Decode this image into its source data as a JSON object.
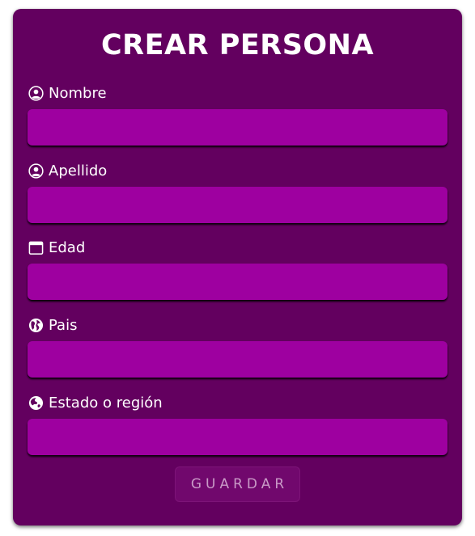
{
  "form": {
    "title": "CREAR PERSONA",
    "fields": [
      {
        "label": "Nombre",
        "icon": "user-circle-icon",
        "value": ""
      },
      {
        "label": "Apellido",
        "icon": "user-circle-icon",
        "value": ""
      },
      {
        "label": "Edad",
        "icon": "calendar-icon",
        "value": ""
      },
      {
        "label": "Pais",
        "icon": "globe-americas-icon",
        "value": ""
      },
      {
        "label": "Estado o región",
        "icon": "globe-asia-icon",
        "value": ""
      }
    ],
    "save_label": "GUARDAR"
  },
  "colors": {
    "card_background": "#63005f",
    "input_background": "#9e00a0",
    "text": "#ffffff",
    "button_text": "#c99ac7"
  }
}
